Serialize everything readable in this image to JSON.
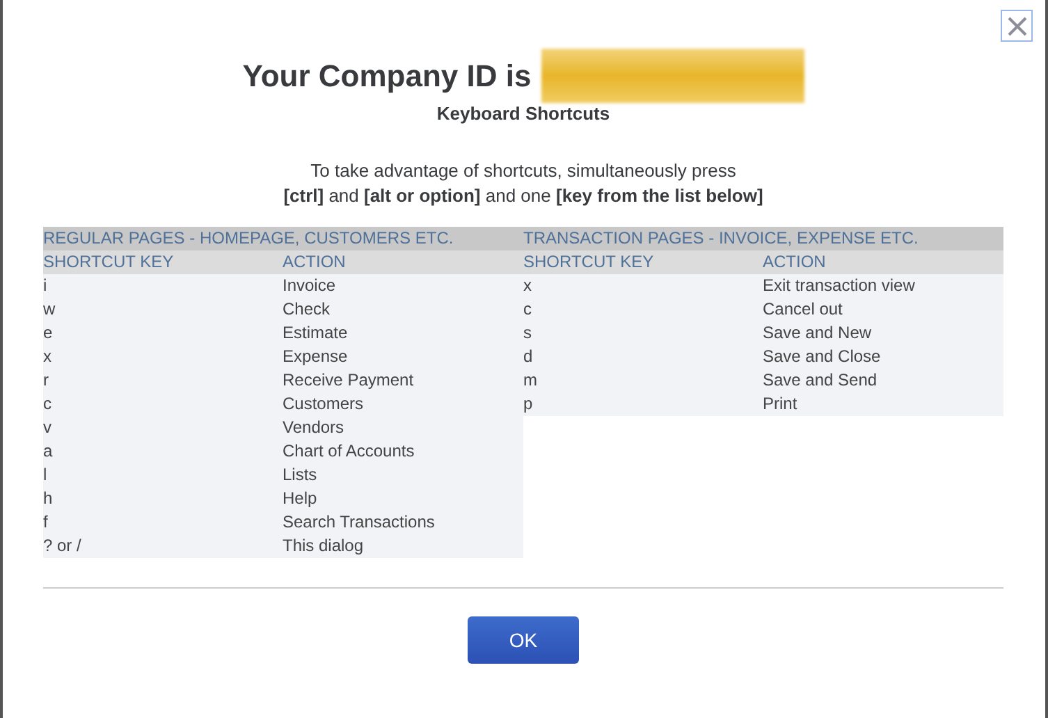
{
  "title": "Your Company ID is",
  "subtitle": "Keyboard Shortcuts",
  "instructions": "To take advantage of shortcuts, simultaneously press\n**[ctrl]** and **[alt or option]** and one **[key from the list below]**",
  "sections": [
    {
      "heading": "REGULAR PAGES - HOMEPAGE, CUSTOMERS ETC.",
      "columns": [
        "SHORTCUT KEY",
        "ACTION"
      ],
      "rows": [
        [
          "i",
          "Invoice"
        ],
        [
          "w",
          "Check"
        ],
        [
          "e",
          "Estimate"
        ],
        [
          "x",
          "Expense"
        ],
        [
          "r",
          "Receive Payment"
        ],
        [
          "c",
          "Customers"
        ],
        [
          "v",
          "Vendors"
        ],
        [
          "a",
          "Chart of Accounts"
        ],
        [
          "l",
          "Lists"
        ],
        [
          "h",
          "Help"
        ],
        [
          "f",
          "Search Transactions"
        ],
        [
          "? or /",
          "This dialog"
        ]
      ]
    },
    {
      "heading": "TRANSACTION PAGES - INVOICE, EXPENSE ETC.",
      "columns": [
        "SHORTCUT KEY",
        "ACTION"
      ],
      "rows": [
        [
          "x",
          "Exit transaction view"
        ],
        [
          "c",
          "Cancel out"
        ],
        [
          "s",
          "Save and New"
        ],
        [
          "d",
          "Save and Close"
        ],
        [
          "m",
          "Save and Send"
        ],
        [
          "p",
          "Print"
        ]
      ]
    }
  ],
  "buttons": [
    "OK"
  ]
}
